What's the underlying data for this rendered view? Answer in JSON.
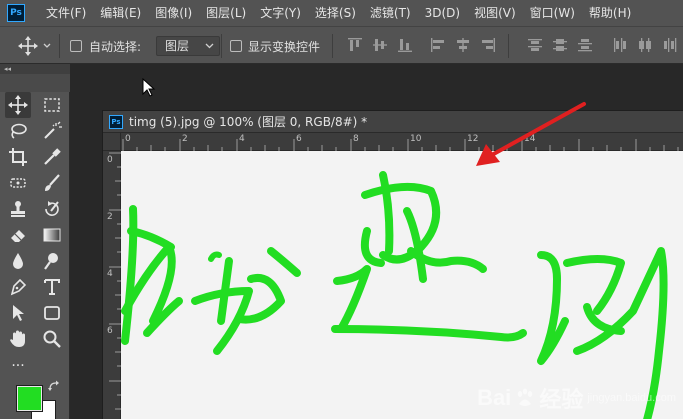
{
  "app": {
    "logo": "Ps"
  },
  "menu": {
    "items": [
      "文件(F)",
      "编辑(E)",
      "图像(I)",
      "图层(L)",
      "文字(Y)",
      "选择(S)",
      "滤镜(T)",
      "3D(D)",
      "视图(V)",
      "窗口(W)",
      "帮助(H)"
    ]
  },
  "options": {
    "auto_select_label": "自动选择:",
    "auto_select_value": "图层",
    "auto_select_checked": false,
    "show_transform_label": "显示变换控件",
    "show_transform_checked": false
  },
  "toolbar": {
    "collapse_glyph": "◂◂",
    "more_tools": "...",
    "foreground_color": "#22dd22",
    "background_color": "#ffffff"
  },
  "document": {
    "icon": "Ps",
    "title": "timg (5).jpg @ 100% (图层 0, RGB/8#) *",
    "ruler_top_labels": [
      "0",
      "2",
      "4",
      "6",
      "8",
      "10",
      "12",
      "14"
    ],
    "ruler_left_labels": [
      "0",
      "2",
      "4",
      "6"
    ],
    "stroke_color": "#22dd22",
    "canvas_color": "#f3f3f3"
  },
  "watermark": {
    "brand": "Bai",
    "brand2": "经验",
    "sub": "jingyan.baidu.com"
  },
  "annotation": {
    "arrow_color": "#e02020"
  }
}
